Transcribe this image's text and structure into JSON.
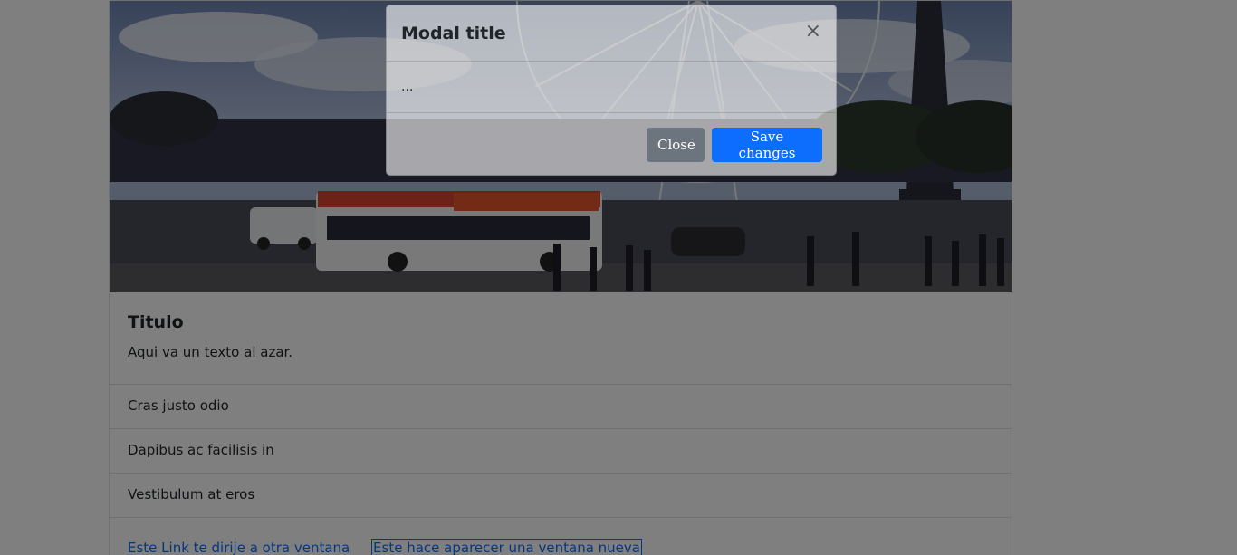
{
  "card": {
    "title": "Titulo",
    "text": "Aqui va un texto al azar.",
    "list_items": [
      "Cras justo odio",
      "Dapibus ac facilisis in",
      "Vestibulum at eros"
    ],
    "links": [
      "Este Link te dirije a otra ventana",
      "Este hace aparecer una ventana nueva"
    ]
  },
  "modal": {
    "title": "Modal title",
    "close_symbol": "×",
    "body": "...",
    "close_label": "Close",
    "save_label": "Save changes"
  }
}
